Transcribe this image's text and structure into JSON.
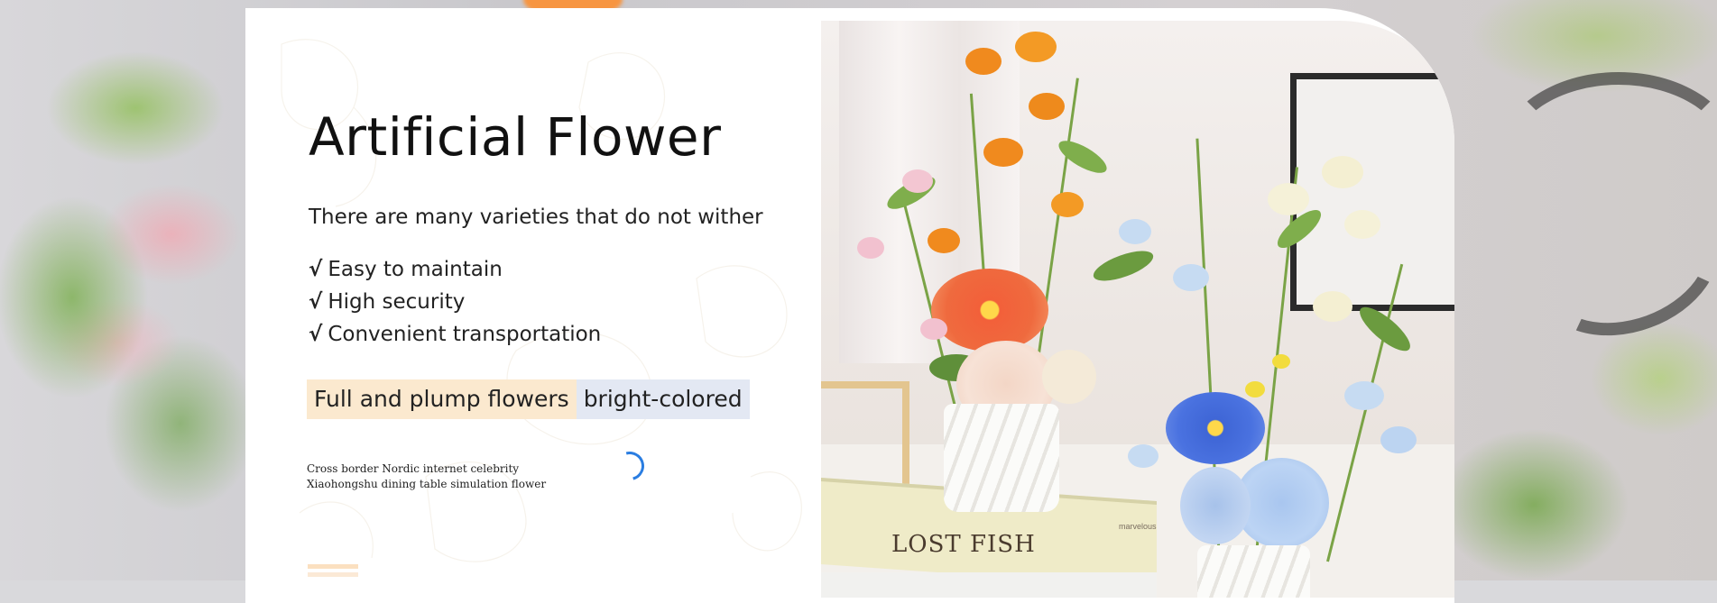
{
  "banner": {
    "title": "Artificial Flower",
    "subtitle": "There are many varieties that do not wither",
    "features": [
      "Easy to maintain",
      "High security",
      "Convenient transportation"
    ],
    "check_mark": "√",
    "tags": [
      "Full and plump flowers",
      "bright-colored"
    ],
    "caption_lines": [
      "Cross border Nordic internet celebrity",
      "Xiaohongshu dining table simulation flower"
    ]
  },
  "photo": {
    "book_title": "LOST FISH",
    "book_small_text": "marvelous"
  },
  "colors": {
    "tag_warm": "#fbe9cf",
    "tag_cool": "#e3e8f3",
    "spinner": "#2a7de1",
    "card": "#ffffff"
  }
}
